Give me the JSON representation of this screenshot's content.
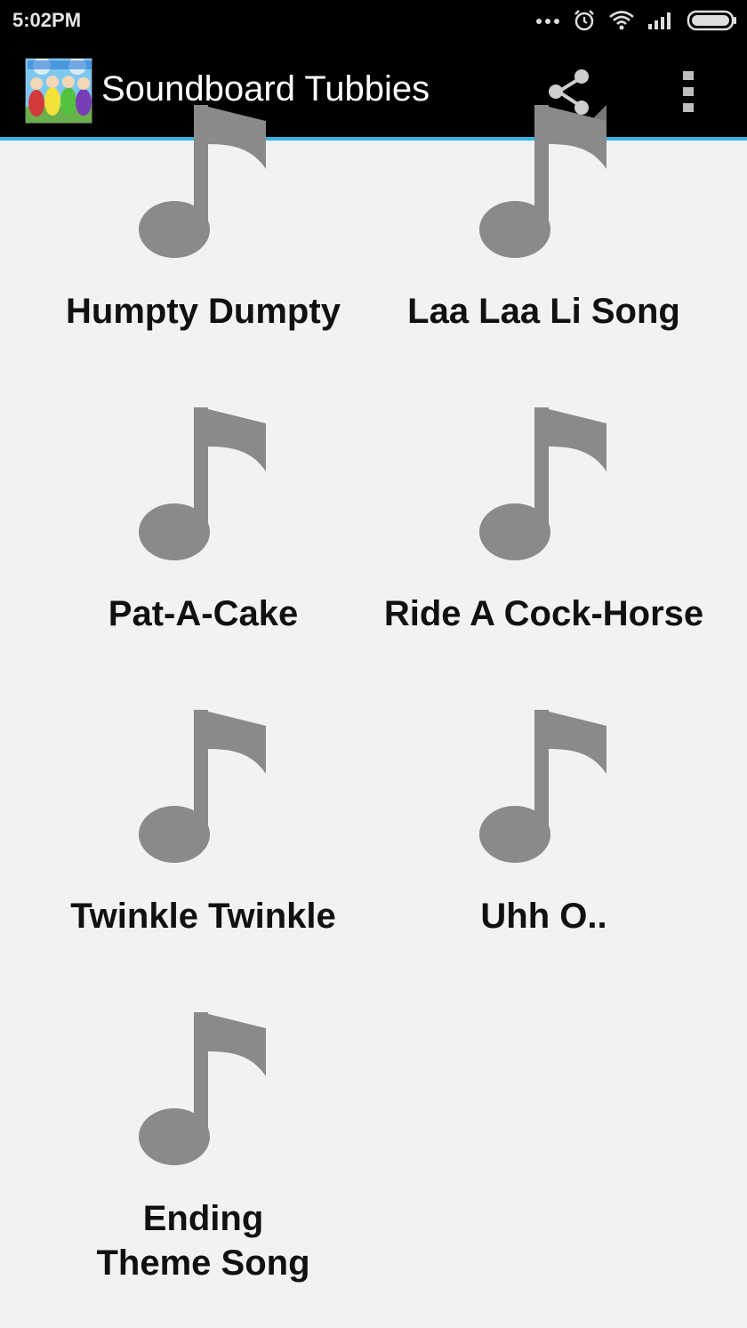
{
  "status_bar": {
    "time": "5:02PM",
    "icons": [
      "more-dots-icon",
      "alarm-icon",
      "wifi-icon",
      "signal-icon",
      "battery-icon"
    ]
  },
  "action_bar": {
    "app_icon": "app-logo-icon",
    "title": "Soundboard Tubbies",
    "actions": [
      "share-icon",
      "overflow-menu-icon"
    ]
  },
  "colors": {
    "background": "#f2f2f2",
    "bar": "#000000",
    "accent_line": "#33b5e5",
    "note_icon": "#8a8a8a",
    "label_text": "#111111"
  },
  "sounds": [
    {
      "label": "Humpty Dumpty",
      "icon": "music-note-icon"
    },
    {
      "label": "Laa Laa Li Song",
      "icon": "music-note-icon"
    },
    {
      "label": "Pat-A-Cake",
      "icon": "music-note-icon"
    },
    {
      "label": "Ride A Cock-Horse",
      "icon": "music-note-icon"
    },
    {
      "label": "Twinkle Twinkle",
      "icon": "music-note-icon"
    },
    {
      "label": "Uhh O..",
      "icon": "music-note-icon"
    },
    {
      "label": "Ending Theme Song",
      "icon": "music-note-icon"
    }
  ]
}
